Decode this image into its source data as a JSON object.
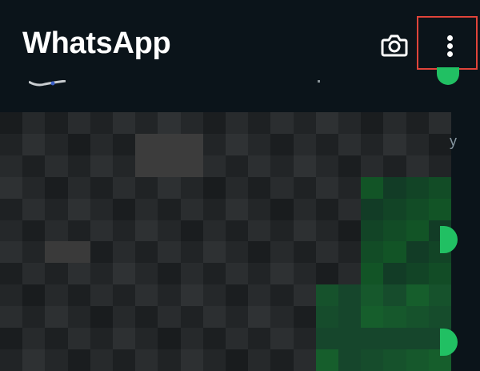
{
  "header": {
    "title": "WhatsApp",
    "camera_icon": "camera-icon",
    "menu_icon": "more-vertical-icon"
  },
  "list": {
    "side_text": "y"
  },
  "colors": {
    "background": "#0b141a",
    "accent_green": "#21c063",
    "highlight_border": "#e0443a"
  }
}
